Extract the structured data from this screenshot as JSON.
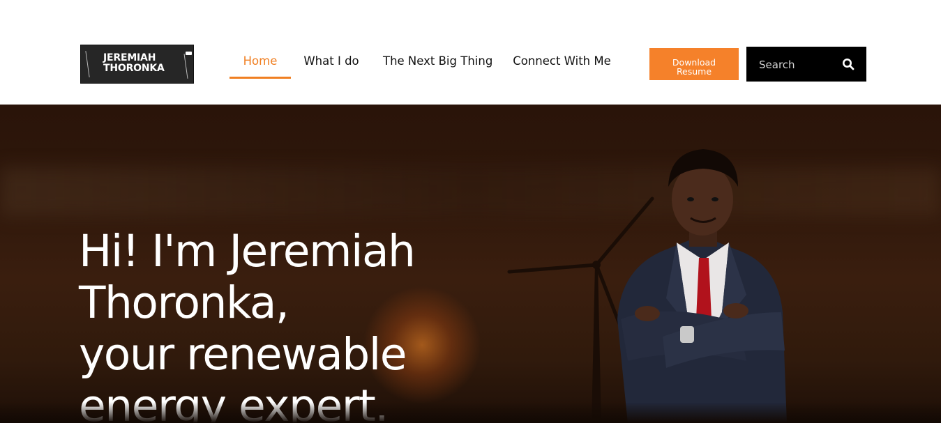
{
  "header": {
    "logo": {
      "line1": "JEREMIAH",
      "line2": "THORONKA"
    },
    "nav": [
      {
        "label": "Home",
        "active": true
      },
      {
        "label": "What I do",
        "active": false
      },
      {
        "label": "The Next Big Thing",
        "active": false
      },
      {
        "label": "Connect With Me",
        "active": false
      }
    ],
    "download_button": {
      "line1": "Download",
      "line2": "Resume"
    },
    "search": {
      "placeholder": "Search"
    }
  },
  "hero": {
    "title_lines": [
      "Hi! I'm Jeremiah",
      "Thoronka,",
      "your renewable",
      "energy expert."
    ]
  },
  "colors": {
    "accent": "#f5812a",
    "nav_text": "#111111",
    "search_bg": "#000000",
    "hero_bg": "#2e170b",
    "hero_text": "#ffffff"
  },
  "icons": [
    "search-icon",
    "wind-turbine-icon"
  ]
}
